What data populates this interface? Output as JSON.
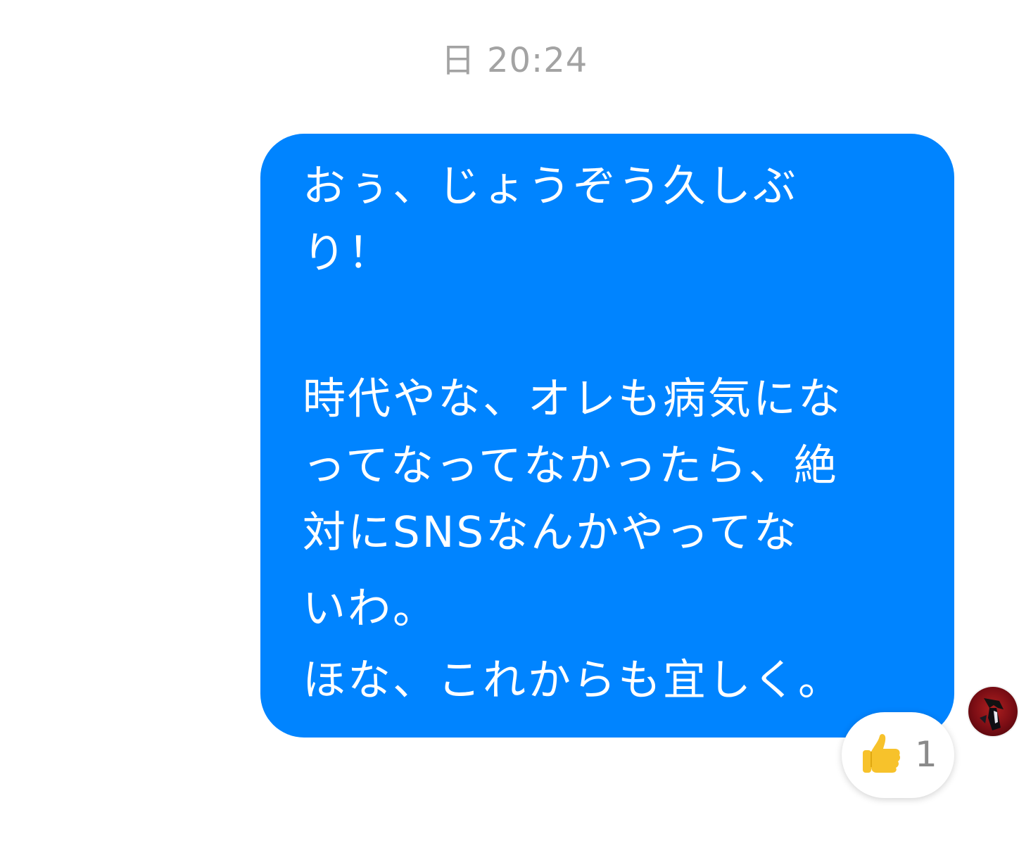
{
  "conversation": {
    "timestamp": "日 20:24"
  },
  "message": {
    "lines": [
      "おぅ、じょうぞう久しぶ",
      "り！",
      "時代やな、オレも病気にな",
      "ってなってなかったら、絶",
      "対にSNSなんかやってな",
      "いわ。",
      "ほな、これからも宜しく。"
    ],
    "bubble_color": "#0084ff",
    "text_color": "#ffffff"
  },
  "reaction": {
    "icon": "thumbs-up-icon",
    "count": "1"
  },
  "seen_avatar": {
    "icon": "avatar"
  }
}
